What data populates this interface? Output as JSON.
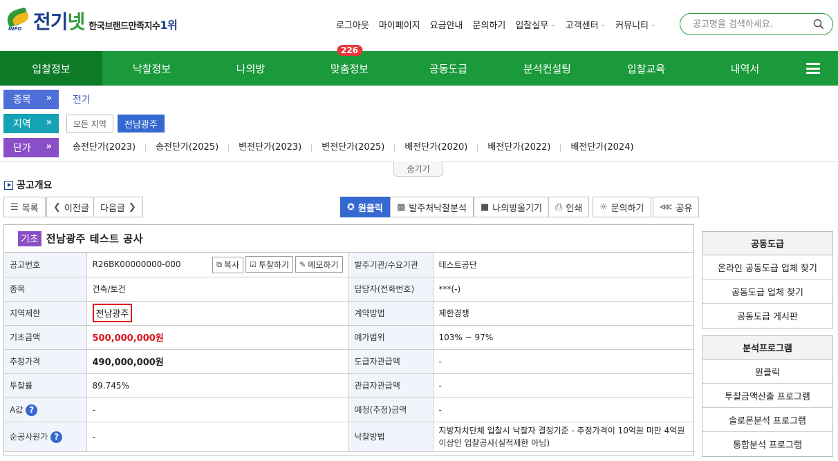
{
  "brand": {
    "name_main": "전기",
    "name_accent": "넷",
    "logo_small": "INFO",
    "slogan": "한국브랜드만족지수",
    "slogan_rank": "1위"
  },
  "topnav": [
    {
      "label": "로그아웃",
      "dropdown": false
    },
    {
      "label": "마이페이지",
      "dropdown": false
    },
    {
      "label": "요금안내",
      "dropdown": false
    },
    {
      "label": "문의하기",
      "dropdown": false
    },
    {
      "label": "입찰실무",
      "dropdown": true
    },
    {
      "label": "고객센터",
      "dropdown": true
    },
    {
      "label": "커뮤니티",
      "dropdown": true
    }
  ],
  "search": {
    "placeholder": "공고명을 검색하세요."
  },
  "mainnav": {
    "items": [
      "입찰정보",
      "낙찰정보",
      "나의방",
      "맞춤정보",
      "공동도급",
      "분석컨설팅",
      "입찰교육",
      "내역서"
    ],
    "badge": "226",
    "active": "입찰정보"
  },
  "filters": {
    "category_label": "종목",
    "category_value": "전기",
    "region_label": "지역",
    "region_all": "모든 지역",
    "region_selected": "전남광주",
    "price_label": "단가",
    "price_items": [
      "송전단가(2023)",
      "송전단가(2025)",
      "변전단가(2023)",
      "변전단가(2025)",
      "배전단가(2020)",
      "배전단가(2022)",
      "배전단가(2024)"
    ],
    "hide_label": "숨기기"
  },
  "section": {
    "title": "공고개요"
  },
  "toolbar": {
    "list": "목록",
    "prev": "이전글",
    "next": "다음글",
    "oneclick": "원클릭",
    "orderer_analysis": "발주처낙찰분석",
    "save_to_room": "나의방옮기기",
    "print": "인쇄",
    "inquire": "문의하기",
    "share": "공유"
  },
  "notice": {
    "tag": "기초",
    "title": "전남광주 테스트 공사",
    "rows": [
      {
        "l1": "공고번호",
        "v1": "R26BK00000000-000",
        "l2": "발주기관/수요기관",
        "v2": "테스트공단"
      },
      {
        "l1": "종목",
        "v1": "건축/토건",
        "l2": "담당자(전화번호)",
        "v2": "***(-)"
      },
      {
        "l1": "지역제한",
        "v1": "전남광주",
        "l2": "계약방법",
        "v2": "제한경쟁"
      },
      {
        "l1": "기초금액",
        "v1": "500,000,000원",
        "l2": "예가범위",
        "v2": "103% ~ 97%"
      },
      {
        "l1": "추정가격",
        "v1": "490,000,000원",
        "l2": "도급자관급액",
        "v2": "-"
      },
      {
        "l1": "투찰률",
        "v1": "89.745%",
        "l2": "관급자관급액",
        "v2": "-"
      },
      {
        "l1": "A값",
        "v1": "-",
        "l2": "예정(추정)금액",
        "v2": "-"
      },
      {
        "l1": "순공사원가",
        "v1": "-",
        "l2": "낙찰방법",
        "v2": "지방자치단체 입찰시 낙찰자 결정기준 - 추정가격이 10억원 미만 4억원 이상인 입찰공사(실적제한 아님)"
      }
    ],
    "copy_btn": "복사",
    "bid_btn": "투찰하기",
    "memo_btn": "메모하기"
  },
  "sidebar": {
    "joint_title": "공동도급",
    "joint_items": [
      "온라인 공동도급 업체 찾기",
      "공동도급 업체 찾기",
      "공동도급 게시판"
    ],
    "analysis_title": "분석프로그램",
    "analysis_items": [
      "원클릭",
      "투찰금액산출 프로그램",
      "솔로몬분석 프로그램",
      "통합분석 프로그램"
    ]
  },
  "colors": {
    "green": "#1a9a3a",
    "green_active": "#0c7a27",
    "blue": "#3569d0",
    "purple": "#8a4fc6",
    "teal": "#16a2b5",
    "red": "#d8141a"
  }
}
